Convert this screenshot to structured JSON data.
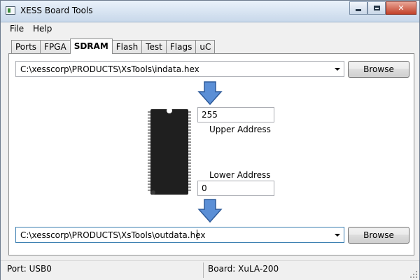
{
  "window": {
    "title": "XESS Board Tools",
    "minimize_icon": "minimize-icon",
    "maximize_icon": "maximize-icon",
    "close_symbol": "✕"
  },
  "menu": {
    "items": [
      "File",
      "Help"
    ]
  },
  "tabs": {
    "items": [
      "Ports",
      "FPGA",
      "SDRAM",
      "Flash",
      "Test",
      "Flags",
      "uC"
    ],
    "selected": "SDRAM"
  },
  "sdram": {
    "upload_file": {
      "value": "C:\\xesscorp\\PRODUCTS\\XsTools\\indata.hex",
      "browse_label": "Browse"
    },
    "download_file": {
      "value": "C:\\xesscorp\\PRODUCTS\\XsTools\\outdata.hex",
      "browse_label": "Browse"
    },
    "upper_address": {
      "value": "255",
      "label": "Upper Address"
    },
    "lower_address": {
      "value": "0",
      "label": "Lower Address"
    },
    "arrow_icon": "down-arrow-icon",
    "chip_image": "sdram-chip-image"
  },
  "status": {
    "port": "Port: USB0",
    "board": "Board: XuLA-200"
  },
  "colors": {
    "arrow_fill": "#5b8fd6",
    "arrow_stroke": "#2f5b9a",
    "chip_body": "#1f1f1f",
    "focus_border": "#3c7fb1"
  }
}
